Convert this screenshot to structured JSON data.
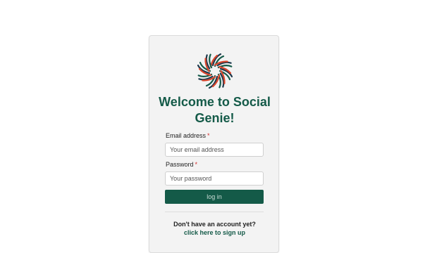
{
  "brand": {
    "logo_icon": "starburst-logo-icon",
    "colors": {
      "primary": "#145a48",
      "accent": "#d9452b",
      "navy": "#1f3a4d"
    }
  },
  "login": {
    "title": "Welcome to Social Genie!",
    "email_label": "Email address",
    "email_placeholder": "Your email address",
    "password_label": "Password",
    "password_placeholder": "Your password",
    "required_marker": "*",
    "submit_label": "log in",
    "no_account_text": "Don't have an account yet?",
    "signup_link_text": "click here to sign up"
  }
}
